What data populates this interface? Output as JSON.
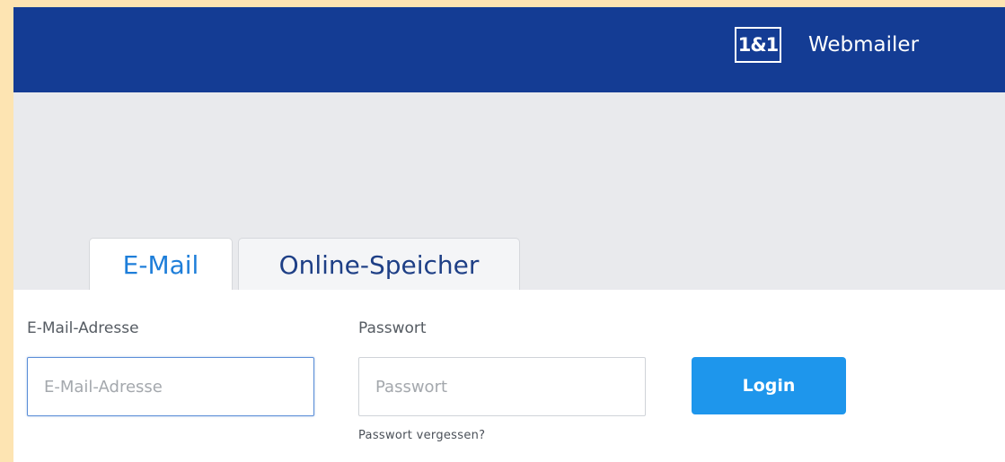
{
  "header": {
    "logo_text": "1&1",
    "app_name": "Webmailer"
  },
  "tabs": [
    {
      "label": "E-Mail",
      "active": true
    },
    {
      "label": "Online-Speicher",
      "active": false
    }
  ],
  "form": {
    "email_label": "E-Mail-Adresse",
    "email_placeholder": "E-Mail-Adresse",
    "email_value": "",
    "password_label": "Passwort",
    "password_placeholder": "Passwort",
    "password_value": "",
    "login_button": "Login",
    "forgot_link": "Passwort vergessen?"
  },
  "colors": {
    "header_bg": "#143c94",
    "active_tab_text": "#1e7ed9",
    "login_button_bg": "#1e96ec",
    "page_grey": "#e9eaed"
  }
}
